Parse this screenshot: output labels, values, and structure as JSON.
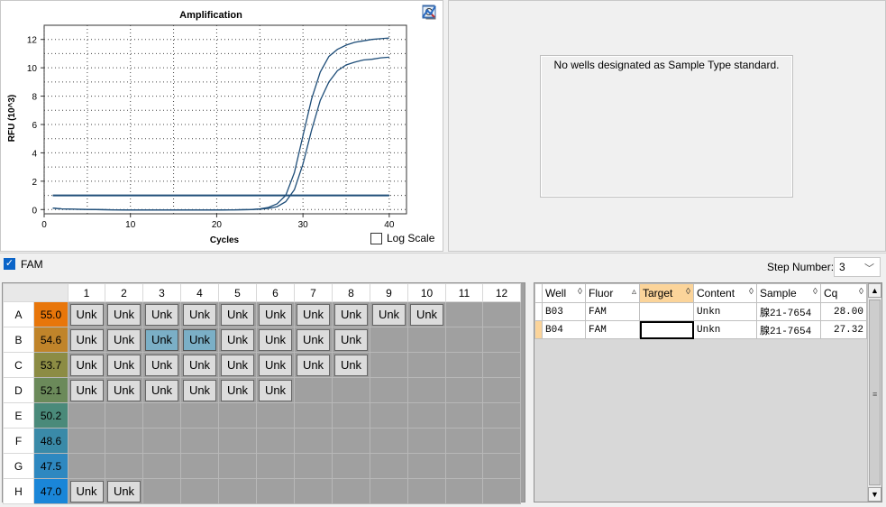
{
  "chart": {
    "title": "Amplification",
    "ylabel": "RFU (10^3)",
    "xlabel": "Cycles",
    "log_scale_label": "Log Scale",
    "log_scale_checked": false
  },
  "chart_data": {
    "type": "line",
    "title": "Amplification",
    "xlabel": "Cycles",
    "ylabel": "RFU (10^3)",
    "xlim": [
      0,
      42
    ],
    "ylim": [
      -0.3,
      13
    ],
    "xticks": [
      0,
      10,
      20,
      30,
      40
    ],
    "yticks": [
      0,
      2,
      4,
      6,
      8,
      10,
      12
    ],
    "grid": true,
    "threshold": 1.0,
    "series": [
      {
        "x": [
          1,
          2,
          4,
          6,
          8,
          10,
          12,
          14,
          16,
          18,
          20,
          22,
          24,
          25,
          26,
          27,
          28,
          29,
          30,
          31,
          32,
          33,
          34,
          35,
          36,
          37,
          38,
          39,
          40
        ],
        "y": [
          0.1,
          0.05,
          0.02,
          0.0,
          -0.02,
          -0.03,
          -0.03,
          -0.03,
          -0.03,
          -0.03,
          -0.03,
          -0.02,
          0.0,
          0.05,
          0.15,
          0.4,
          1.0,
          2.6,
          5.2,
          7.8,
          9.7,
          10.8,
          11.3,
          11.6,
          11.8,
          11.9,
          12.0,
          12.05,
          12.1
        ],
        "color": "#1f4e79"
      },
      {
        "x": [
          1,
          2,
          4,
          6,
          8,
          10,
          12,
          14,
          16,
          18,
          20,
          22,
          24,
          25,
          26,
          27,
          28,
          29,
          30,
          31,
          32,
          33,
          34,
          35,
          36,
          37,
          38,
          39,
          40
        ],
        "y": [
          0.1,
          0.05,
          0.02,
          0.0,
          -0.02,
          -0.03,
          -0.03,
          -0.03,
          -0.03,
          -0.03,
          -0.03,
          -0.02,
          0.0,
          0.03,
          0.08,
          0.2,
          0.55,
          1.4,
          3.2,
          5.6,
          7.7,
          9.0,
          9.8,
          10.2,
          10.4,
          10.55,
          10.6,
          10.7,
          10.75
        ],
        "color": "#1f4e79"
      }
    ]
  },
  "std_curve": {
    "message": "No wells designated as Sample Type standard."
  },
  "fluor": {
    "name": "FAM",
    "checked": true
  },
  "step": {
    "label": "Step Number:",
    "value": "3"
  },
  "plate": {
    "columns": [
      "1",
      "2",
      "3",
      "4",
      "5",
      "6",
      "7",
      "8",
      "9",
      "10",
      "11",
      "12"
    ],
    "rows": [
      {
        "label": "A",
        "temp": "55.0",
        "color": "#e8760a",
        "wells": [
          "Unk",
          "Unk",
          "Unk",
          "Unk",
          "Unk",
          "Unk",
          "Unk",
          "Unk",
          "Unk",
          "Unk",
          "",
          ""
        ],
        "selected": []
      },
      {
        "label": "B",
        "temp": "54.6",
        "color": "#c0842a",
        "wells": [
          "Unk",
          "Unk",
          "Unk",
          "Unk",
          "Unk",
          "Unk",
          "Unk",
          "Unk",
          "",
          "",
          "",
          ""
        ],
        "selected": [
          2,
          3
        ]
      },
      {
        "label": "C",
        "temp": "53.7",
        "color": "#8c8c44",
        "wells": [
          "Unk",
          "Unk",
          "Unk",
          "Unk",
          "Unk",
          "Unk",
          "Unk",
          "Unk",
          "",
          "",
          "",
          ""
        ],
        "selected": []
      },
      {
        "label": "D",
        "temp": "52.1",
        "color": "#6b8a5a",
        "wells": [
          "Unk",
          "Unk",
          "Unk",
          "Unk",
          "Unk",
          "Unk",
          "",
          "",
          "",
          "",
          "",
          ""
        ],
        "selected": []
      },
      {
        "label": "E",
        "temp": "50.2",
        "color": "#4a8a7a",
        "wells": [
          "",
          "",
          "",
          "",
          "",
          "",
          "",
          "",
          "",
          "",
          "",
          ""
        ],
        "selected": []
      },
      {
        "label": "F",
        "temp": "48.6",
        "color": "#3a8aa8",
        "wells": [
          "",
          "",
          "",
          "",
          "",
          "",
          "",
          "",
          "",
          "",
          "",
          ""
        ],
        "selected": []
      },
      {
        "label": "G",
        "temp": "47.5",
        "color": "#2e88c0",
        "wells": [
          "",
          "",
          "",
          "",
          "",
          "",
          "",
          "",
          "",
          "",
          "",
          ""
        ],
        "selected": []
      },
      {
        "label": "H",
        "temp": "47.0",
        "color": "#1a86d8",
        "wells": [
          "Unk",
          "Unk",
          "",
          "",
          "",
          "",
          "",
          "",
          "",
          "",
          "",
          ""
        ],
        "selected": []
      }
    ]
  },
  "grid": {
    "headers": [
      "Well",
      "Fluor",
      "Target",
      "Content",
      "Sample",
      "Cq"
    ],
    "sort_glyphs": [
      "◊",
      "▵",
      "◊",
      "◊",
      "◊",
      "◊"
    ],
    "active_header": 2,
    "rows": [
      {
        "well": "B03",
        "fluor": "FAM",
        "target": "",
        "content": "Unkn",
        "sample": "腺21-7654",
        "cq": "28.00"
      },
      {
        "well": "B04",
        "fluor": "FAM",
        "target": "",
        "content": "Unkn",
        "sample": "腺21-7654",
        "cq": "27.32"
      }
    ]
  }
}
